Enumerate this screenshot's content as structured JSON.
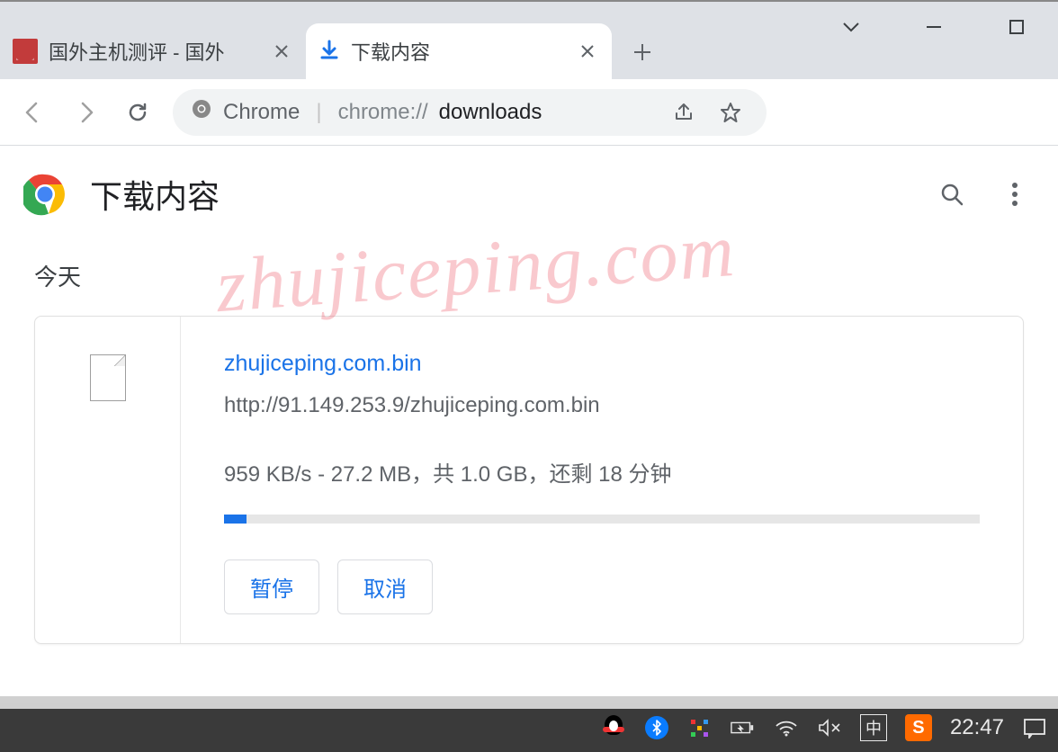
{
  "tabs": {
    "inactive": {
      "title": "国外主机测评 - 国外"
    },
    "active": {
      "title": "下载内容"
    }
  },
  "omnibox": {
    "label": "Chrome",
    "url_prefix": "chrome://",
    "url_highlight": "downloads"
  },
  "downloads_page": {
    "title": "下载内容",
    "date_section": "今天"
  },
  "download_item": {
    "filename": "zhujiceping.com.bin",
    "source_url": "http://91.149.253.9/zhujiceping.com.bin",
    "progress_text": "959 KB/s - 27.2 MB，共 1.0 GB，还剩 18 分钟",
    "progress_percent": 3,
    "pause_label": "暂停",
    "cancel_label": "取消"
  },
  "watermark": "zhujiceping.com",
  "taskbar": {
    "ime": "中",
    "sogou": "S",
    "clock": "22:47"
  }
}
